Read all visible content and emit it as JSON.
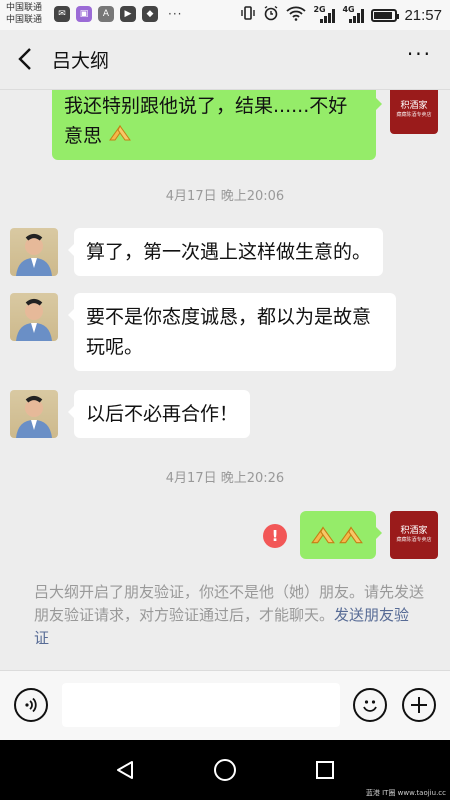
{
  "status_bar": {
    "carrier_1": "中国联通",
    "carrier_2": "中国联通",
    "signal_1_label": "2G",
    "signal_2_label": "4G",
    "battery_level": 0.9,
    "time": "21:57",
    "overflow": "···"
  },
  "header": {
    "title": "吕大纲",
    "more": "···"
  },
  "messages": [
    {
      "direction": "out",
      "text": "我还特别跟他说了，结果......不好意思"
    },
    {
      "type": "timestamp",
      "text": "4月17日 晚上20:06"
    },
    {
      "direction": "in",
      "text": "算了，第一次遇上这样做生意的。"
    },
    {
      "direction": "in",
      "text": "要不是你态度诚恳，都以为是故意玩呢。"
    },
    {
      "direction": "in",
      "text": "以后不必再合作！"
    },
    {
      "type": "timestamp",
      "text": "4月17日 晚上20:26"
    },
    {
      "direction": "out",
      "text": "",
      "emoji": [
        "praying-hands",
        "praying-hands"
      ],
      "failed": true
    }
  ],
  "brand_avatar": {
    "name": "积酒家",
    "sub": "藏藏陈酒专卖店"
  },
  "notice": {
    "text": "吕大纲开启了朋友验证，你还不是他（她）朋友。请先发送朋友验证请求，对方验证通过后，才能聊天。",
    "link": "发送朋友验证"
  },
  "watermark": "蓝港 IT圈 www.taojiu.cc",
  "colors": {
    "out_bubble": "#95ec69",
    "in_bubble": "#ffffff",
    "background": "#ededed",
    "link": "#576b95",
    "error": "#f25757",
    "brand_avatar": "#9a1b1b"
  }
}
